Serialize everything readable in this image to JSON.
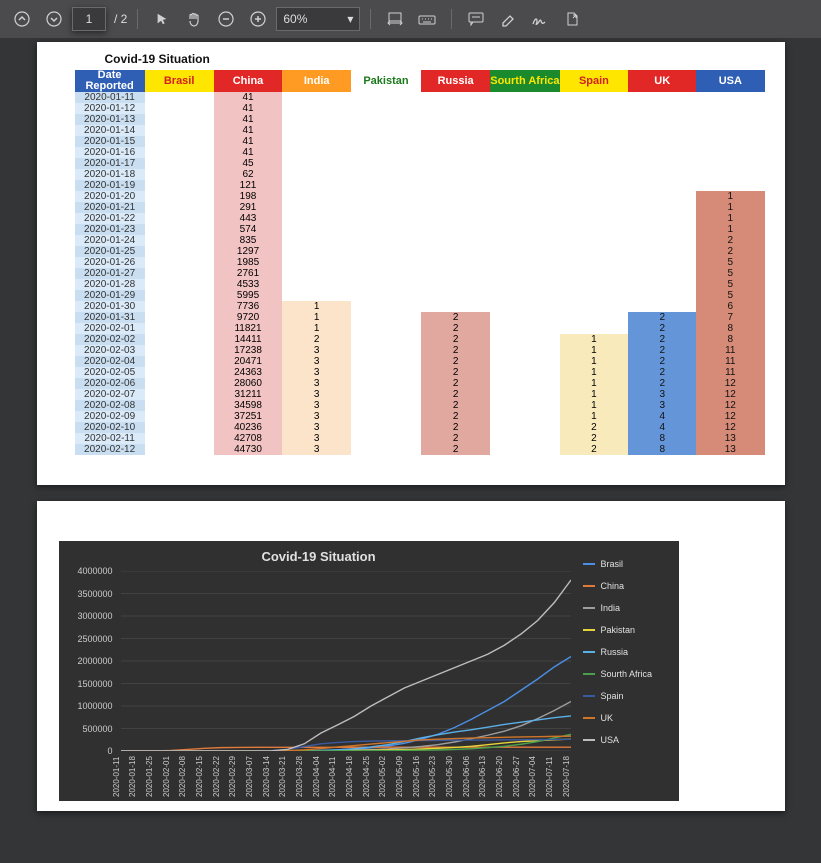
{
  "toolbar": {
    "current_page": "1",
    "total_label": "/ 2",
    "zoom_label": "60%"
  },
  "page1": {
    "title": "Covid-19 Situation",
    "columns": [
      "Date Reported",
      "Brasil",
      "China",
      "India",
      "Pakistan",
      "Russia",
      "Sourth Africa",
      "Spain",
      "UK",
      "USA"
    ]
  },
  "table_rows": [
    {
      "date": "2020-01-11",
      "china": "41"
    },
    {
      "date": "2020-01-12",
      "china": "41"
    },
    {
      "date": "2020-01-13",
      "china": "41"
    },
    {
      "date": "2020-01-14",
      "china": "41"
    },
    {
      "date": "2020-01-15",
      "china": "41"
    },
    {
      "date": "2020-01-16",
      "china": "41"
    },
    {
      "date": "2020-01-17",
      "china": "45"
    },
    {
      "date": "2020-01-18",
      "china": "62"
    },
    {
      "date": "2020-01-19",
      "china": "121"
    },
    {
      "date": "2020-01-20",
      "china": "198",
      "usa": "1"
    },
    {
      "date": "2020-01-21",
      "china": "291",
      "usa": "1"
    },
    {
      "date": "2020-01-22",
      "china": "443",
      "usa": "1"
    },
    {
      "date": "2020-01-23",
      "china": "574",
      "usa": "1"
    },
    {
      "date": "2020-01-24",
      "china": "835",
      "usa": "2"
    },
    {
      "date": "2020-01-25",
      "china": "1297",
      "usa": "2"
    },
    {
      "date": "2020-01-26",
      "china": "1985",
      "usa": "5"
    },
    {
      "date": "2020-01-27",
      "china": "2761",
      "usa": "5"
    },
    {
      "date": "2020-01-28",
      "china": "4533",
      "usa": "5"
    },
    {
      "date": "2020-01-29",
      "china": "5995",
      "usa": "5"
    },
    {
      "date": "2020-01-30",
      "china": "7736",
      "india": "1",
      "usa": "6"
    },
    {
      "date": "2020-01-31",
      "china": "9720",
      "india": "1",
      "russia": "2",
      "uk": "2",
      "usa": "7"
    },
    {
      "date": "2020-02-01",
      "china": "11821",
      "india": "1",
      "russia": "2",
      "uk": "2",
      "usa": "8"
    },
    {
      "date": "2020-02-02",
      "china": "14411",
      "india": "2",
      "russia": "2",
      "spain": "1",
      "uk": "2",
      "usa": "8"
    },
    {
      "date": "2020-02-03",
      "china": "17238",
      "india": "3",
      "russia": "2",
      "spain": "1",
      "uk": "2",
      "usa": "11"
    },
    {
      "date": "2020-02-04",
      "china": "20471",
      "india": "3",
      "russia": "2",
      "spain": "1",
      "uk": "2",
      "usa": "11"
    },
    {
      "date": "2020-02-05",
      "china": "24363",
      "india": "3",
      "russia": "2",
      "spain": "1",
      "uk": "2",
      "usa": "11"
    },
    {
      "date": "2020-02-06",
      "china": "28060",
      "india": "3",
      "russia": "2",
      "spain": "1",
      "uk": "2",
      "usa": "12"
    },
    {
      "date": "2020-02-07",
      "china": "31211",
      "india": "3",
      "russia": "2",
      "spain": "1",
      "uk": "3",
      "usa": "12"
    },
    {
      "date": "2020-02-08",
      "china": "34598",
      "india": "3",
      "russia": "2",
      "spain": "1",
      "uk": "3",
      "usa": "12"
    },
    {
      "date": "2020-02-09",
      "china": "37251",
      "india": "3",
      "russia": "2",
      "spain": "1",
      "uk": "4",
      "usa": "12"
    },
    {
      "date": "2020-02-10",
      "china": "40236",
      "india": "3",
      "russia": "2",
      "spain": "2",
      "uk": "4",
      "usa": "12"
    },
    {
      "date": "2020-02-11",
      "china": "42708",
      "india": "3",
      "russia": "2",
      "spain": "2",
      "uk": "8",
      "usa": "13"
    },
    {
      "date": "2020-02-12",
      "china": "44730",
      "india": "3",
      "russia": "2",
      "spain": "2",
      "uk": "8",
      "usa": "13"
    }
  ],
  "chart_data": {
    "type": "line",
    "title": "Covid-19 Situation",
    "y_ticks": [
      "0",
      "500000",
      "1000000",
      "1500000",
      "2000000",
      "2500000",
      "3000000",
      "3500000",
      "4000000"
    ],
    "ylim": [
      0,
      4000000
    ],
    "x_labels": [
      "2020-01-11",
      "2020-01-18",
      "2020-01-25",
      "2020-02-01",
      "2020-02-08",
      "2020-02-15",
      "2020-02-22",
      "2020-02-29",
      "2020-03-07",
      "2020-03-14",
      "2020-03-21",
      "2020-03-28",
      "2020-04-04",
      "2020-04-11",
      "2020-04-18",
      "2020-04-25",
      "2020-05-02",
      "2020-05-09",
      "2020-05-16",
      "2020-05-23",
      "2020-05-30",
      "2020-06-06",
      "2020-06-13",
      "2020-06-20",
      "2020-06-27",
      "2020-07-04",
      "2020-07-11",
      "2020-07-18"
    ],
    "x_sample": [
      0,
      1,
      2,
      3,
      4,
      5,
      6,
      7,
      8,
      9,
      10,
      11,
      12,
      13,
      14,
      15,
      16,
      17,
      18,
      19,
      20,
      21,
      22,
      23,
      24,
      25,
      26,
      27
    ],
    "series": [
      {
        "name": "Brasil",
        "color": "#4a8ee6",
        "values": [
          0,
          0,
          0,
          0,
          0,
          0,
          0,
          0,
          0,
          0,
          0,
          4000,
          12000,
          25000,
          40000,
          70000,
          110000,
          170000,
          260000,
          370000,
          520000,
          700000,
          900000,
          1100000,
          1350000,
          1600000,
          1870000,
          2100000
        ]
      },
      {
        "name": "China",
        "color": "#e07a3a",
        "values": [
          41,
          120,
          2000,
          12000,
          35000,
          60000,
          75000,
          80000,
          81000,
          81000,
          81500,
          82000,
          82500,
          83000,
          83500,
          84000,
          84000,
          84000,
          84000,
          84000,
          84000,
          84000,
          84000,
          84000,
          84000,
          84000,
          85000,
          85000
        ]
      },
      {
        "name": "India",
        "color": "#9e9e9e",
        "values": [
          0,
          0,
          0,
          1,
          3,
          3,
          3,
          3,
          40,
          100,
          350,
          1000,
          4000,
          10000,
          20000,
          30000,
          45000,
          70000,
          100000,
          140000,
          200000,
          270000,
          350000,
          440000,
          560000,
          720000,
          900000,
          1100000
        ]
      },
      {
        "name": "Pakistan",
        "color": "#e6d23a",
        "values": [
          0,
          0,
          0,
          0,
          0,
          0,
          0,
          0,
          0,
          30,
          800,
          2000,
          5000,
          8000,
          12000,
          16000,
          22000,
          32000,
          45000,
          60000,
          80000,
          105000,
          140000,
          180000,
          210000,
          230000,
          250000,
          265000
        ]
      },
      {
        "name": "Russia",
        "color": "#5bb0e8",
        "values": [
          0,
          0,
          0,
          2,
          2,
          2,
          2,
          2,
          20,
          60,
          300,
          2000,
          10000,
          25000,
          50000,
          90000,
          140000,
          210000,
          290000,
          360000,
          420000,
          470000,
          530000,
          590000,
          640000,
          690000,
          740000,
          780000
        ]
      },
      {
        "name": "Sourth Africa",
        "color": "#4aa04a",
        "values": [
          0,
          0,
          0,
          0,
          0,
          0,
          0,
          0,
          0,
          20,
          300,
          1300,
          2000,
          3000,
          4000,
          6000,
          8000,
          12000,
          18000,
          25000,
          35000,
          50000,
          75000,
          105000,
          150000,
          210000,
          290000,
          370000
        ]
      },
      {
        "name": "Spain",
        "color": "#3a5aa0",
        "values": [
          0,
          0,
          0,
          0,
          0,
          2,
          2,
          10,
          400,
          7000,
          35000,
          100000,
          160000,
          190000,
          210000,
          220000,
          225000,
          228000,
          232000,
          236000,
          240000,
          242000,
          244000,
          247000,
          250000,
          253000,
          256000,
          260000
        ]
      },
      {
        "name": "UK",
        "color": "#d0762a",
        "values": [
          0,
          0,
          0,
          2,
          4,
          9,
          13,
          23,
          200,
          1100,
          6000,
          25000,
          55000,
          90000,
          120000,
          155000,
          185000,
          215000,
          245000,
          262000,
          276000,
          288000,
          296000,
          305000,
          312000,
          318000,
          325000,
          330000
        ]
      },
      {
        "name": "USA",
        "color": "#bdbdbd",
        "values": [
          0,
          0,
          5,
          8,
          12,
          15,
          60,
          70,
          400,
          3000,
          35000,
          160000,
          400000,
          580000,
          770000,
          1000000,
          1200000,
          1400000,
          1550000,
          1700000,
          1850000,
          2000000,
          2150000,
          2350000,
          2600000,
          2900000,
          3300000,
          3800000
        ]
      }
    ]
  }
}
